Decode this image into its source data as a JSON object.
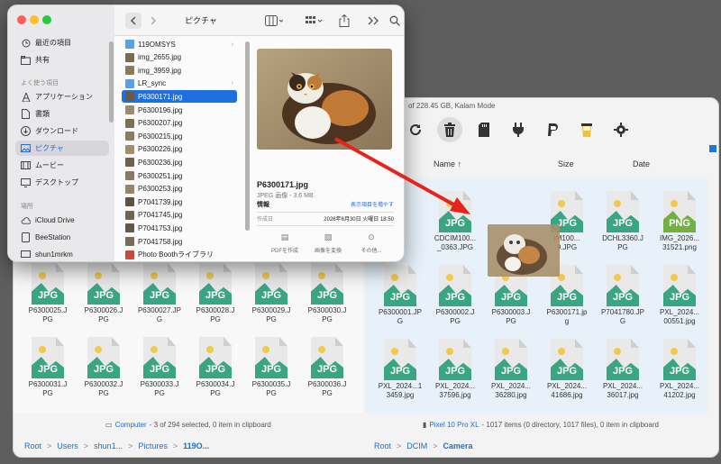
{
  "android": {
    "status": "of 228.45 GB, Kalam Mode",
    "toolbar_icons": [
      "refresh-icon",
      "trash-icon",
      "sd-card-icon",
      "plug-icon",
      "paypal-icon",
      "cup-icon",
      "gear-icon"
    ],
    "headers": {
      "name": "Name ↑",
      "size": "Size",
      "date": "Date"
    },
    "left_row1": [
      {
        "name": "P6300025.JPG",
        "l1": "P6300025.J",
        "l2": "PG"
      },
      {
        "name": "P6300026.JPG",
        "l1": "P6300026.J",
        "l2": "PG"
      },
      {
        "name": "P6300027.JPG",
        "l1": "P6300027.JP",
        "l2": "G"
      },
      {
        "name": "P6300028.JPG",
        "l1": "P6300028.J",
        "l2": "PG"
      },
      {
        "name": "P6300029.JPG",
        "l1": "P6300029.J",
        "l2": "PG"
      },
      {
        "name": "P6300030.JPG",
        "l1": "P6300030.J",
        "l2": "PG"
      }
    ],
    "left_row2": [
      {
        "name": "P6300031.JPG",
        "l1": "P6300031.J",
        "l2": "PG"
      },
      {
        "name": "P6300032.JPG",
        "l1": "P6300032.J",
        "l2": "PG"
      },
      {
        "name": "P6300033.JPG",
        "l1": "P6300033.J",
        "l2": "PG"
      },
      {
        "name": "P6300034.JPG",
        "l1": "P6300034.J",
        "l2": "PG"
      },
      {
        "name": "P6300035.JPG",
        "l1": "P6300035.J",
        "l2": "PG"
      },
      {
        "name": "P6300036.JPG",
        "l1": "P6300036.J",
        "l2": "PG"
      }
    ],
    "right_row1": [
      {
        "l1": ".6...",
        "l2": ""
      },
      {
        "l1": "CDCIM100...",
        "l2": "_0363.JPG"
      },
      {
        "l1": "",
        "l2": ""
      },
      {
        "l1": "IM100...",
        "l2": "9.JPG"
      },
      {
        "l1": "DCHL3360.J",
        "l2": "PG"
      },
      {
        "l1": "IMG_2026...",
        "l2": "31521.png"
      }
    ],
    "right_row2": [
      {
        "l1": "P6300001.JP",
        "l2": "G"
      },
      {
        "l1": "P6300002.J",
        "l2": "PG"
      },
      {
        "l1": "P6300003.J",
        "l2": "PG"
      },
      {
        "l1": "P6300171.jp",
        "l2": "g"
      },
      {
        "l1": "P7041780.JP",
        "l2": "G"
      },
      {
        "l1": "PXL_2024...",
        "l2": "00551.jpg"
      }
    ],
    "right_row3": [
      {
        "l1": "PXL_2024...1",
        "l2": "3459.jpg"
      },
      {
        "l1": "PXL_2024...",
        "l2": "37596.jpg"
      },
      {
        "l1": "PXL_2024...",
        "l2": "36280.jpg"
      },
      {
        "l1": "PXL_2024...",
        "l2": "41686.jpg"
      },
      {
        "l1": "PXL_2024...",
        "l2": "36017.jpg"
      },
      {
        "l1": "PXL_2024...",
        "l2": "41202.jpg"
      }
    ],
    "left_status": {
      "location": "Computer",
      "text": "- 3 of 294 selected, 0 item in clipboard"
    },
    "right_status": {
      "location": "Pixel 10 Pro XL",
      "text": "- 1017 items (0 directory, 1017 files), 0 item in clipboard"
    },
    "left_crumbs": [
      "Root",
      "Users",
      "shun1...",
      "Pictures",
      "119O..."
    ],
    "right_crumbs": [
      "Root",
      "DCIM",
      "Camera"
    ]
  },
  "finder": {
    "title": "ピクチャ",
    "sidebar": {
      "items_top": [
        "最近の項目",
        "共有"
      ],
      "section1": "よく使う項目",
      "favorites": [
        "アプリケーション",
        "書類",
        "ダウンロード",
        "ピクチャ",
        "ムービー",
        "デスクトップ"
      ],
      "section2": "場所",
      "places": [
        "iCloud Drive",
        "BeeStation",
        "shun1mrkm"
      ]
    },
    "files": [
      "119OMSYS",
      "img_2655.jpg",
      "img_3959.jpg",
      "LR_sync",
      "P6300171.jpg",
      "P6300196.jpg",
      "P6300207.jpg",
      "P6300215.jpg",
      "P6300226.jpg",
      "P6300236.jpg",
      "P6300251.jpg",
      "P6300253.jpg",
      "P7041739.jpg",
      "P7041745.jpg",
      "P7041753.jpg",
      "P7041758.jpg",
      "Photo Boothライブラリ"
    ],
    "preview": {
      "name": "P6300171.jpg",
      "kind": "JPEG 画像 - 3.6 MB",
      "info": "情報",
      "more": "表示項目を増やす",
      "created_label": "作成日",
      "created_value": "2026年6月30日 火曜日 18:50",
      "actions": [
        "PDFを作成",
        "画像を変換",
        "その他..."
      ]
    }
  }
}
